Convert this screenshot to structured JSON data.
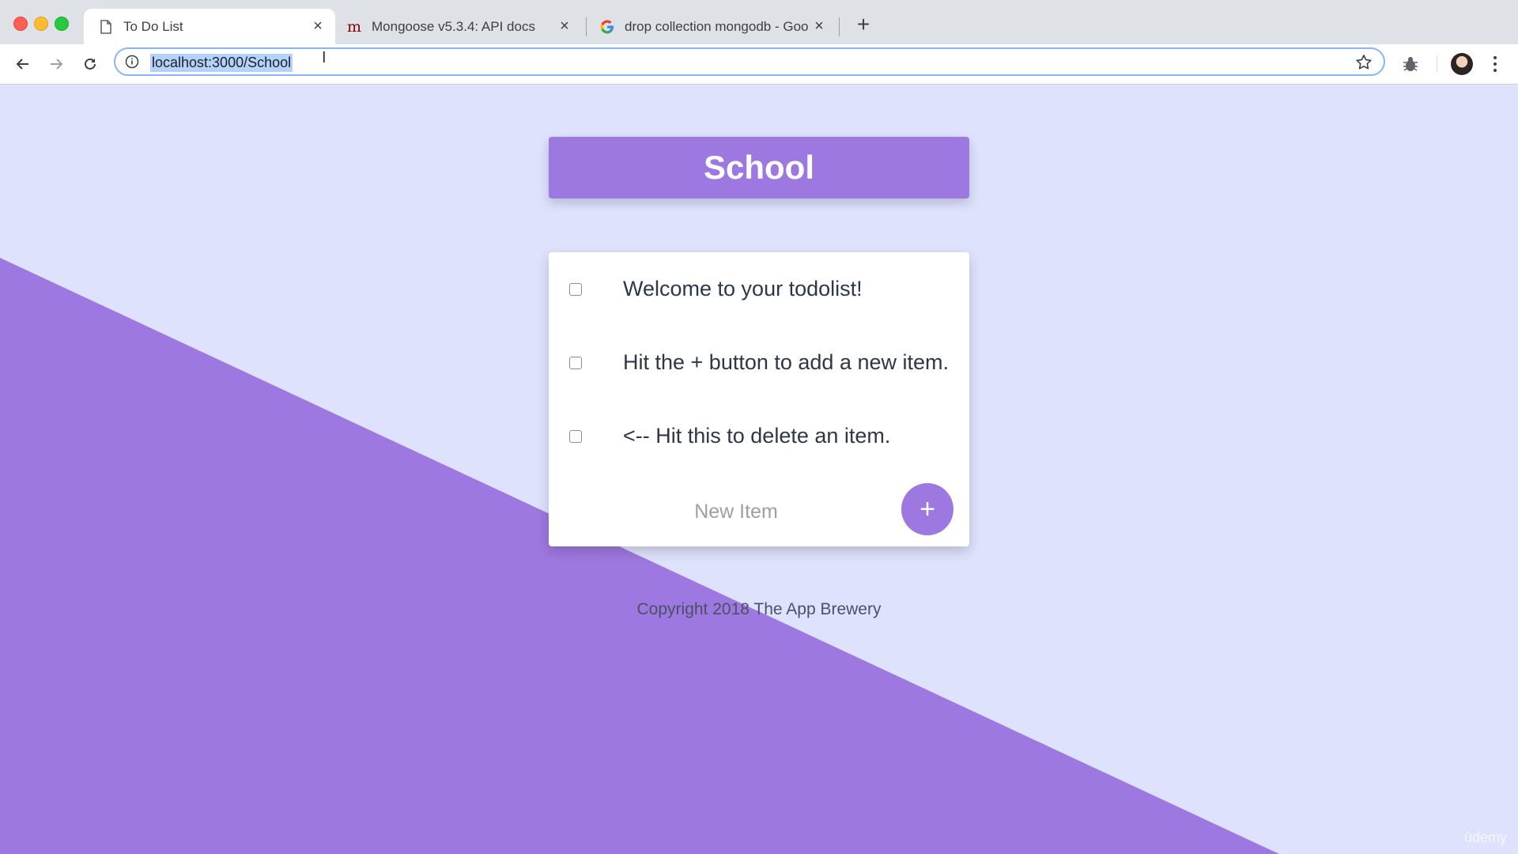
{
  "browser": {
    "tabs": [
      {
        "title": "To Do List",
        "favicon": "document-icon",
        "active": true
      },
      {
        "title": "Mongoose v5.3.4: API docs",
        "favicon": "mongoose-icon",
        "active": false
      },
      {
        "title": "drop collection mongodb - Goo",
        "favicon": "google-icon",
        "active": false
      }
    ],
    "url": "localhost:3000/School",
    "colors": {
      "tabbar": "#dee1e6",
      "url_highlight": "#b3d3fd"
    }
  },
  "page": {
    "list_title": "School",
    "items": [
      {
        "text": "Welcome to your todolist!"
      },
      {
        "text": "Hit the + button to add a new item."
      },
      {
        "text": "<-- Hit this to delete an item."
      }
    ],
    "new_item_placeholder": "New Item",
    "add_label": "+",
    "footer": "Copyright 2018 The App Brewery",
    "colors": {
      "accent": "#9d78e0",
      "background": "#dee2fd"
    }
  },
  "watermark": "ûdemy"
}
